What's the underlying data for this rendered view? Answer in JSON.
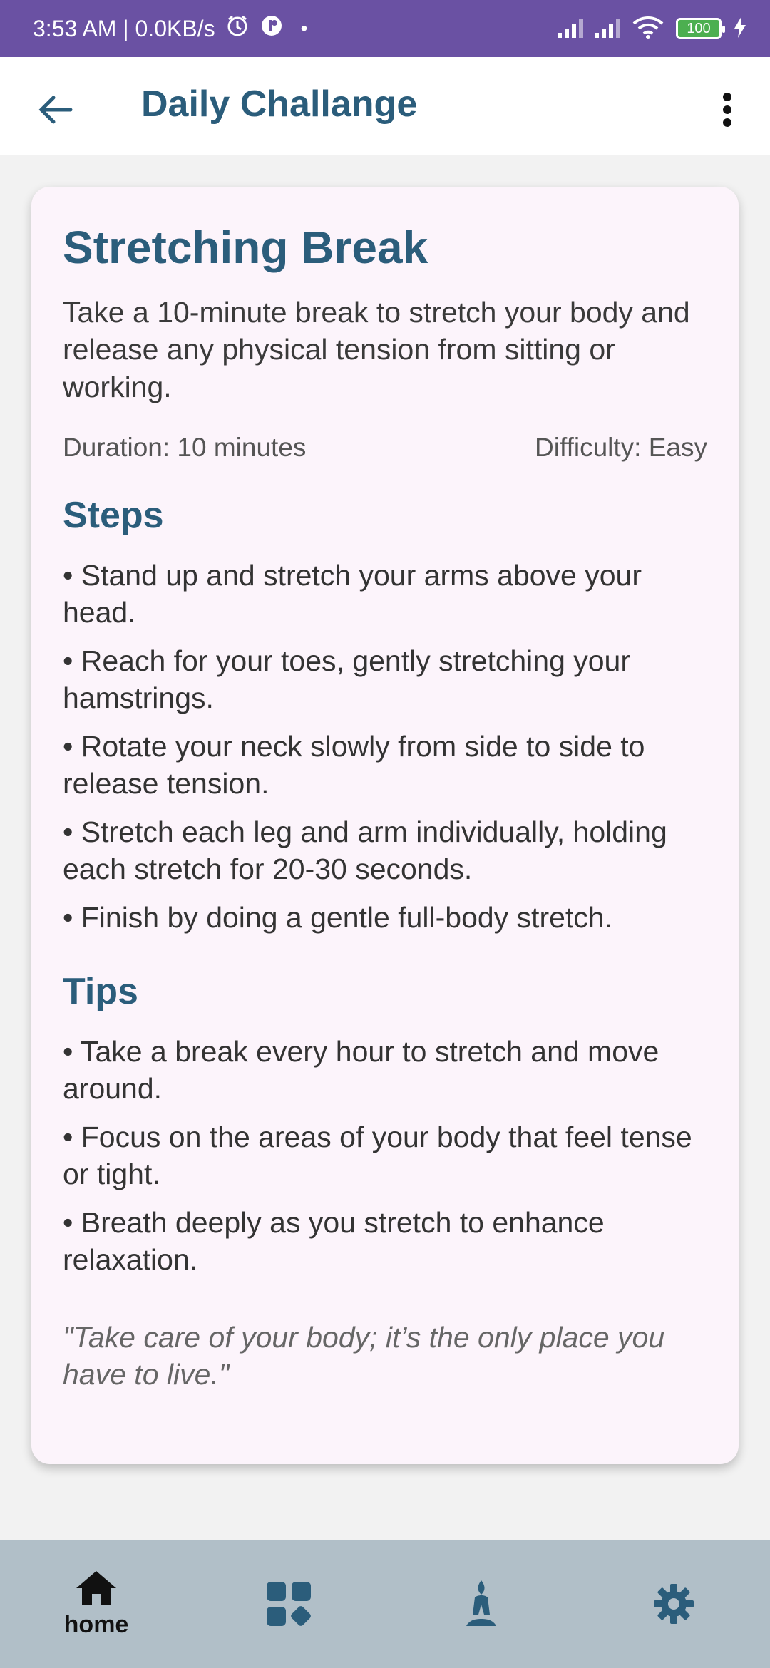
{
  "status_bar": {
    "time_speed": "3:53 AM | 0.0KB/s",
    "battery_level": "100"
  },
  "app_bar": {
    "title": "Daily Challange"
  },
  "challenge": {
    "title": "Stretching Break",
    "description": "Take a 10-minute break to stretch your body and release any physical tension from sitting or working.",
    "duration": "Duration: 10 minutes",
    "difficulty": "Difficulty: Easy",
    "steps_title": "Steps",
    "steps": [
      "• Stand up and stretch your arms above your head.",
      "• Reach for your toes, gently stretching your hamstrings.",
      "• Rotate your neck slowly from side to side to release tension.",
      "• Stretch each leg and arm individually, holding each stretch for 20-30 seconds.",
      "• Finish by doing a gentle full-body stretch."
    ],
    "tips_title": "Tips",
    "tips": [
      "• Take a break every hour to stretch and move around.",
      "• Focus on the areas of your body that feel tense or tight.",
      "• Breath deeply as you stretch to enhance relaxation."
    ],
    "quote": "\"Take care of your body; it’s the only place you have to live.\""
  },
  "bottom_nav": {
    "home_label": "home",
    "icons": [
      "home-icon",
      "dashboard-icon",
      "meditation-icon",
      "settings-icon"
    ]
  },
  "colors": {
    "status_bar": "#6a51a3",
    "accent": "#2b5d7b",
    "card_bg": "#fcf4fb",
    "nav_bg": "#b1bfc8"
  }
}
